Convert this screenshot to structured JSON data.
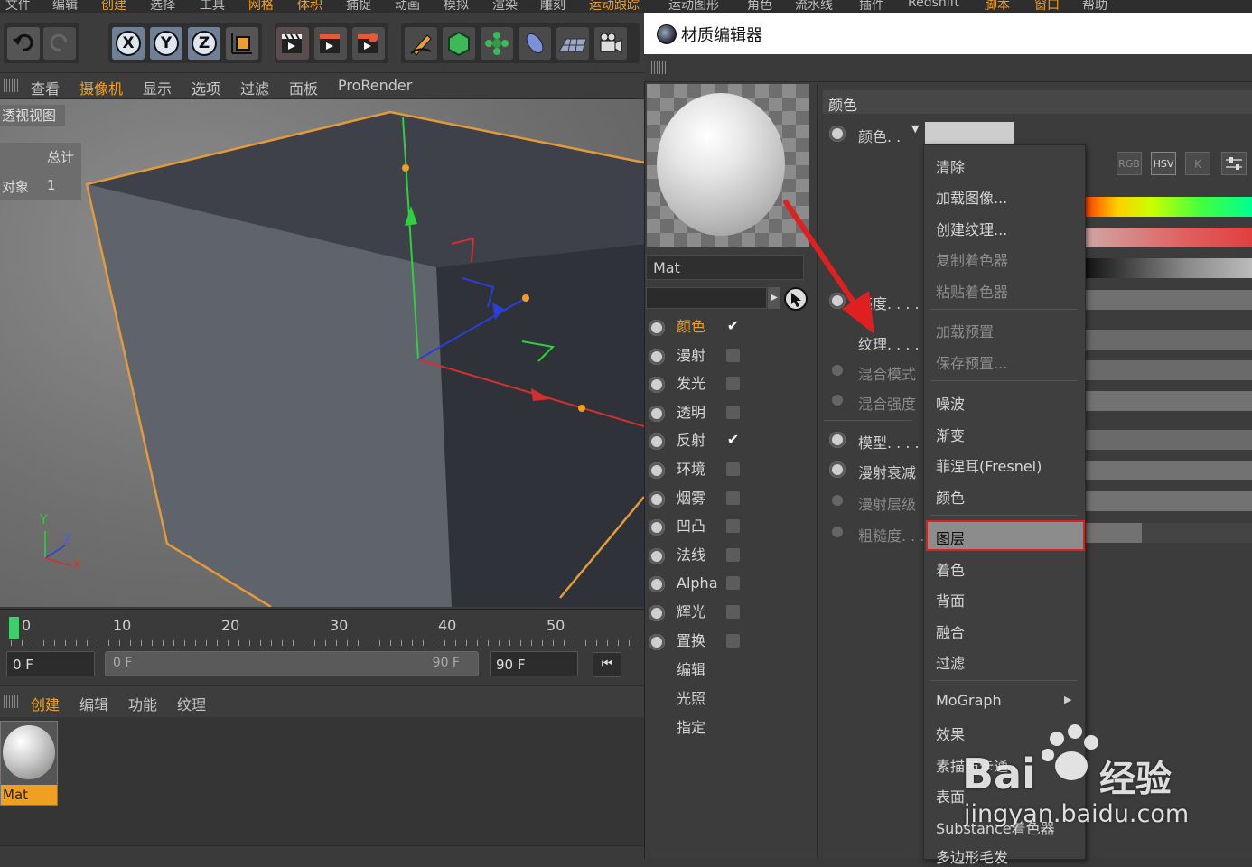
{
  "menubar": {
    "items": [
      "文件",
      "编辑",
      "创建",
      "选择",
      "工具",
      "网格",
      "体积",
      "捕捉",
      "动画",
      "模拟",
      "渲染",
      "雕刻",
      "运动跟踪",
      "运动图形",
      "角色",
      "流水线",
      "插件",
      "Redshift",
      "脚本",
      "窗口",
      "帮助"
    ]
  },
  "toolbar": {
    "axis_x": "X",
    "axis_y": "Y",
    "axis_z": "Z"
  },
  "viewport_menu": {
    "items": [
      "查看",
      "摄像机",
      "显示",
      "选项",
      "过滤",
      "面板",
      "ProRender"
    ],
    "accent_index": 1
  },
  "viewport": {
    "title": "透视视图",
    "stats_header": "总计",
    "stats_label": "对象",
    "stats_value": "1",
    "axis_y": "Y",
    "axis_z": "Z",
    "axis_x": "X"
  },
  "timeline": {
    "ticks": [
      "0",
      "10",
      "20",
      "30",
      "40",
      "50"
    ],
    "start_field": "0 F",
    "range_start": "0 F",
    "range_end": "90 F",
    "end_field": "90 F"
  },
  "material_manager": {
    "menu": [
      "创建",
      "编辑",
      "功能",
      "纹理"
    ],
    "material_name": "Mat"
  },
  "material_editor": {
    "title": "材质编辑器",
    "material_name": "Mat",
    "channels": [
      {
        "label": "颜色",
        "checked": true,
        "active": true
      },
      {
        "label": "漫射",
        "checked": false,
        "active": false
      },
      {
        "label": "发光",
        "checked": false,
        "active": false
      },
      {
        "label": "透明",
        "checked": false,
        "active": false
      },
      {
        "label": "反射",
        "checked": true,
        "active": false
      },
      {
        "label": "环境",
        "checked": false,
        "active": false
      },
      {
        "label": "烟雾",
        "checked": false,
        "active": false
      },
      {
        "label": "凹凸",
        "checked": false,
        "active": false
      },
      {
        "label": "法线",
        "checked": false,
        "active": false
      },
      {
        "label": "Alpha",
        "checked": false,
        "active": false
      },
      {
        "label": "辉光",
        "checked": false,
        "active": false
      },
      {
        "label": "置换",
        "checked": false,
        "active": false
      }
    ],
    "extra_items": [
      "编辑",
      "光照",
      "指定"
    ],
    "section_title": "颜色",
    "attr_color": "颜色. .",
    "attr_brightness": "亮度. . . .",
    "attr_texture": "纹理. . . .",
    "attr_blend_mode": "混合模式",
    "attr_blend_strength": "混合强度",
    "attr_model": "模型. . . .",
    "attr_diffuse_falloff": "漫射衰减",
    "attr_diffuse_level": "漫射层级",
    "attr_roughness": "粗糙度. . .",
    "mode_buttons": [
      "RGB",
      "HSV",
      "K"
    ]
  },
  "dropdown": {
    "group1": [
      "清除",
      "加载图像...",
      "创建纹理...",
      "复制着色器",
      "粘贴着色器"
    ],
    "group2": [
      "加载预置",
      "保存预置..."
    ],
    "group3": [
      "噪波",
      "渐变",
      "菲涅耳(Fresnel)",
      "颜色"
    ],
    "group4": [
      "图层",
      "着色",
      "背面",
      "融合",
      "过滤"
    ],
    "group5": [
      "MoGraph",
      "效果",
      "素描与卡通",
      "表面",
      "Substance着色器",
      "多边形毛发"
    ],
    "highlighted": "图层"
  },
  "watermark": {
    "brand": "Bai",
    "brand2": "经验",
    "url": "jingyan.baidu.com"
  },
  "colors": {
    "accent": "#f0a020",
    "highlight_border": "#e02020",
    "arrow": "#e02020"
  }
}
